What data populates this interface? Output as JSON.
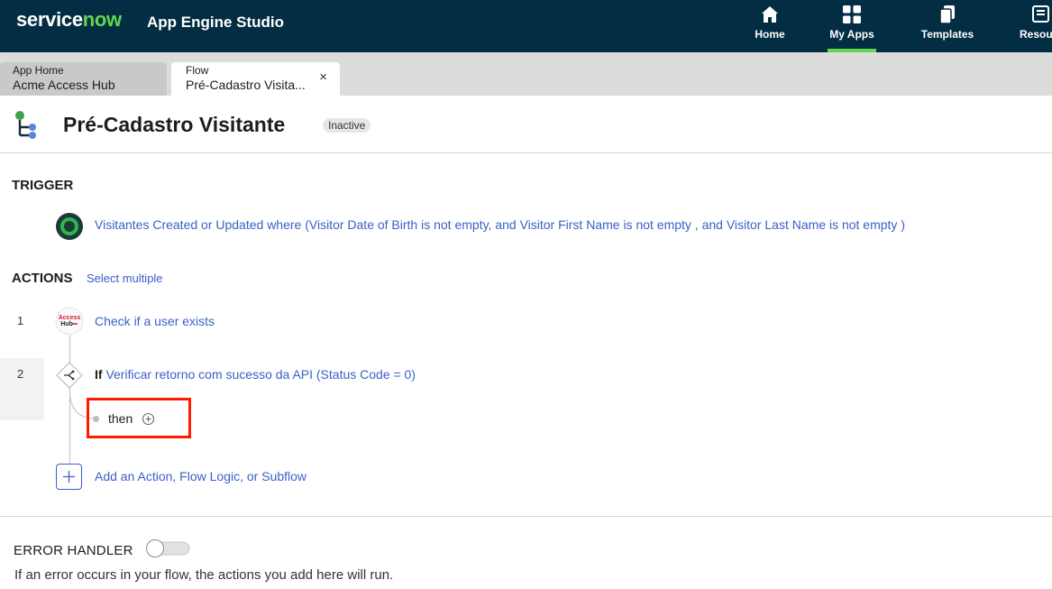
{
  "topbar": {
    "brand_service": "service",
    "brand_now": "now",
    "app_title": "App Engine Studio",
    "nav": [
      {
        "label": "Home",
        "icon": "home-icon"
      },
      {
        "label": "My Apps",
        "icon": "grid-icon",
        "active": true
      },
      {
        "label": "Templates",
        "icon": "templates-icon"
      },
      {
        "label": "Resou",
        "icon": "resources-icon"
      }
    ]
  },
  "tabs": {
    "home": {
      "line1": "App Home",
      "line2": "Acme Access Hub"
    },
    "flow": {
      "line1": "Flow",
      "line2": "Pré-Cadastro Visita...",
      "close": "×"
    }
  },
  "flow": {
    "title": "Pré-Cadastro Visitante",
    "status": "Inactive"
  },
  "trigger": {
    "heading": "TRIGGER",
    "text": "Visitantes Created or Updated where (Visitor Date of Birth is not empty, and Visitor First Name is not empty , and Visitor Last Name is not empty )"
  },
  "actions": {
    "heading": "ACTIONS",
    "select_multiple": "Select multiple",
    "items": [
      {
        "number": "1",
        "label": "Check if a user exists",
        "icon_text": "Access Hub"
      },
      {
        "number": "2",
        "keyword": "If",
        "label": "Verificar retorno com sucesso da API (Status Code = 0)"
      }
    ],
    "then_label": "then",
    "add_label": "Add an Action, Flow Logic, or Subflow"
  },
  "error_handler": {
    "heading": "ERROR HANDLER",
    "enabled": false,
    "description": "If an error occurs in your flow, the actions you add here will run."
  },
  "colors": {
    "topbar": "#032d42",
    "brand_green": "#62d84e",
    "link_blue": "#3b5fc8",
    "highlight": "#ff1a00"
  }
}
